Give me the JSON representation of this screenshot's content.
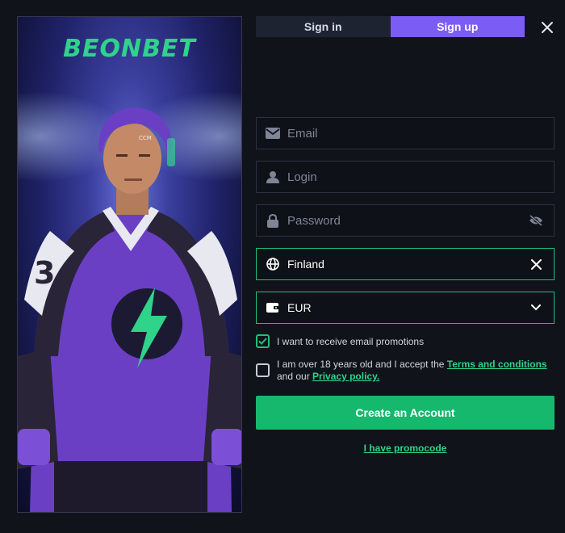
{
  "brand": {
    "logo_text": "BEONBET"
  },
  "tabs": [
    {
      "label": "Sign in",
      "active": false
    },
    {
      "label": "Sign up",
      "active": true
    }
  ],
  "form": {
    "email": {
      "placeholder": "Email",
      "value": ""
    },
    "login": {
      "placeholder": "Login",
      "value": ""
    },
    "password": {
      "placeholder": "Password",
      "value": ""
    },
    "country": {
      "value": "Finland"
    },
    "currency": {
      "value": "EUR"
    }
  },
  "checks": {
    "promotions": {
      "label": "I want to receive email promotions",
      "checked": true
    },
    "terms": {
      "text_before": "I am over 18 years old and I accept the ",
      "terms_link": "Terms and conditions",
      "text_middle": " and our ",
      "privacy_link": "Privacy policy.",
      "checked": false
    }
  },
  "actions": {
    "create_account": "Create an Account",
    "promocode": "I have promocode"
  },
  "colors": {
    "accent_green": "#16b86e",
    "tab_active": "#7b5cf5",
    "background": "#11131a"
  }
}
